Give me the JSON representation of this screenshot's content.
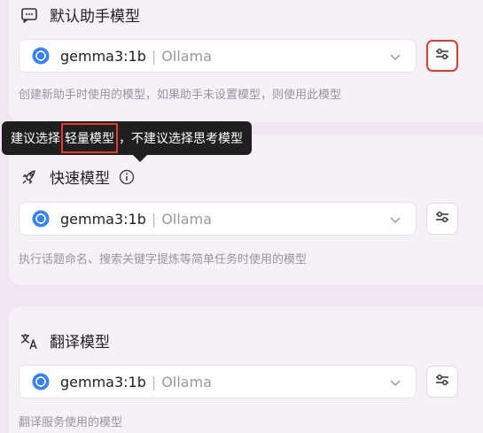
{
  "default_model": {
    "title": "默认助手模型",
    "title_icon": "chat-bubble-icon",
    "model_name": "gemma3:1b",
    "separator": "|",
    "provider": "Ollama",
    "description": "创建新助手时使用的模型，如果助手未设置模型，则使用此模型"
  },
  "tooltip": {
    "part1": "建议选择",
    "highlight": "轻量模型",
    "part2": "，不建议选择思考模型"
  },
  "quick_model": {
    "title": "快速模型",
    "title_icon": "rocket-icon",
    "model_name": "gemma3:1b",
    "separator": "|",
    "provider": "Ollama",
    "description": "执行话题命名、搜索关键字提炼等简单任务时使用的模型"
  },
  "translate_model": {
    "title": "翻译模型",
    "title_icon": "translate-icon",
    "model_name": "gemma3:1b",
    "separator": "|",
    "provider": "Ollama",
    "description": "翻译服务使用的模型"
  },
  "colors": {
    "background": "#efe6f1",
    "card": "#f6f0f7",
    "highlight_border": "#e53935",
    "model_icon_blue": "#3b82f6",
    "tooltip_bg": "#1f1f1f"
  }
}
